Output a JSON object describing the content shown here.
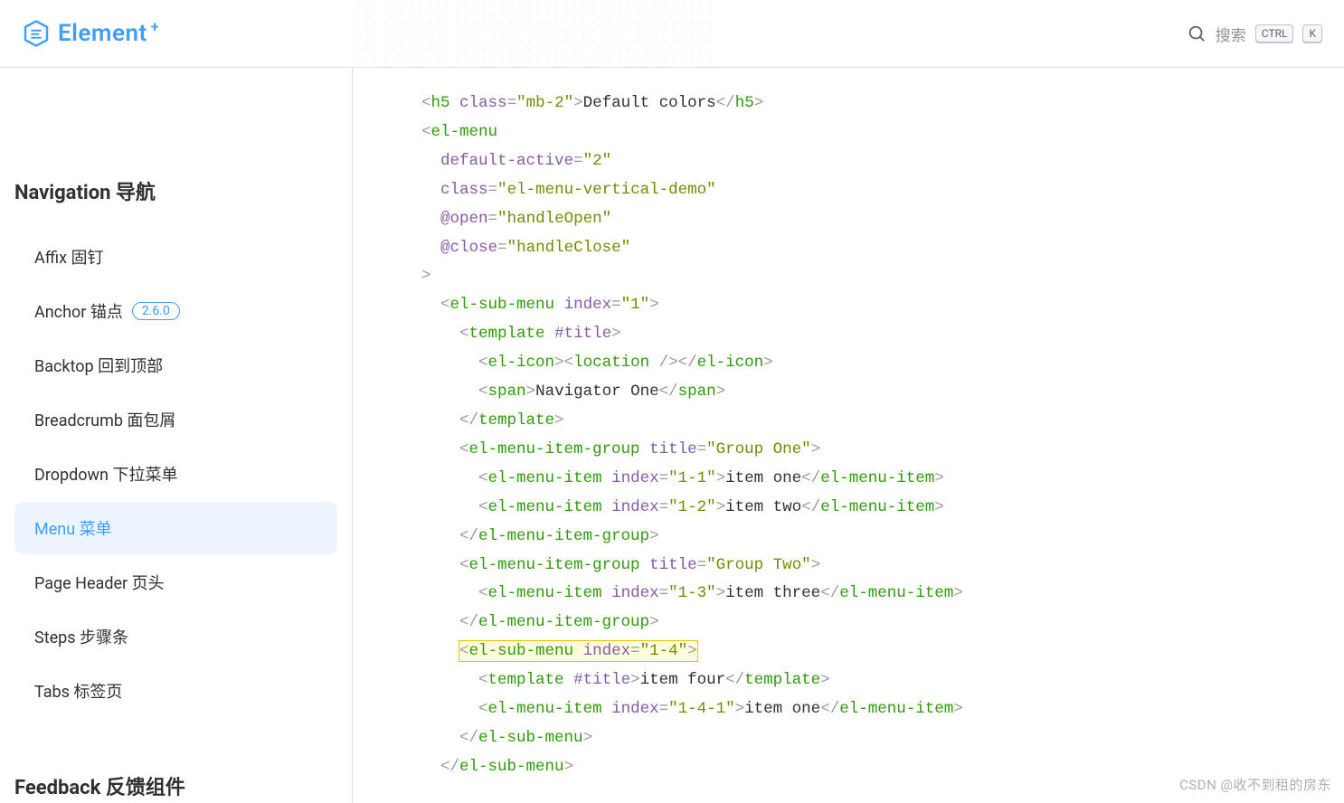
{
  "header": {
    "logo_text": "Element",
    "logo_plus": "+",
    "search_placeholder": "搜索",
    "kbd_ctrl": "CTRL",
    "kbd_k": "K"
  },
  "sidebar": {
    "nav_title": "Navigation 导航",
    "feedback_title": "Feedback 反馈组件",
    "items": [
      {
        "label": "Affix 固钉",
        "badge": "",
        "active": false
      },
      {
        "label": "Anchor 锚点",
        "badge": "2.6.0",
        "active": false
      },
      {
        "label": "Backtop 回到顶部",
        "badge": "",
        "active": false
      },
      {
        "label": "Breadcrumb 面包屑",
        "badge": "",
        "active": false
      },
      {
        "label": "Dropdown 下拉菜单",
        "badge": "",
        "active": false
      },
      {
        "label": "Menu 菜单",
        "badge": "",
        "active": true
      },
      {
        "label": "Page Header 页头",
        "badge": "",
        "active": false
      },
      {
        "label": "Steps 步骤条",
        "badge": "",
        "active": false
      },
      {
        "label": "Tabs 标签页",
        "badge": "",
        "active": false
      }
    ]
  },
  "code": {
    "h5_class": "mb-2",
    "h5_text": "Default colors",
    "menu_default_active": "2",
    "menu_class": "el-menu-vertical-demo",
    "menu_open": "handleOpen",
    "menu_close": "handleClose",
    "sub1_index": "1",
    "icon_tag": "location",
    "span_text": "Navigator One",
    "group1_title": "Group One",
    "item_1_1_index": "1-1",
    "item_1_1_text": "item one",
    "item_1_2_index": "1-2",
    "item_1_2_text": "item two",
    "group2_title": "Group Two",
    "item_1_3_index": "1-3",
    "item_1_3_text": "item three",
    "sub_1_4_index": "1-4",
    "item_four_text": "item four",
    "item_1_4_1_index": "1-4-1",
    "item_1_4_1_text": "item one"
  },
  "watermark": "CSDN @收不到租的房东"
}
